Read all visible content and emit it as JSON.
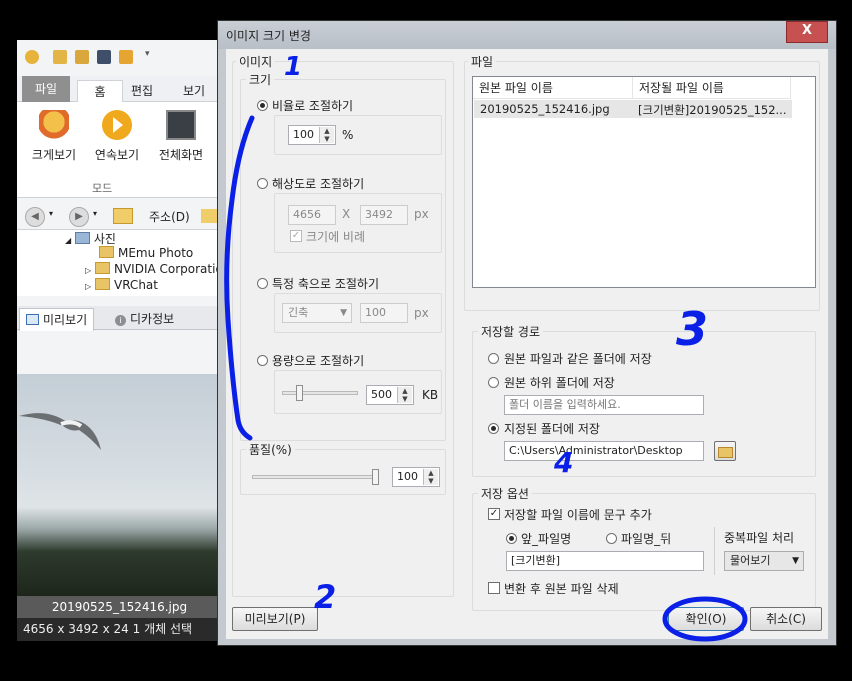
{
  "background_app": {
    "ribbon_tabs": [
      "파일",
      "홈",
      "편집",
      "보기"
    ],
    "ribbon_buttons": [
      "크게보기",
      "연속보기",
      "전체화면"
    ],
    "ribbon_group": "모드",
    "address_label": "주소(D)",
    "tree": {
      "root": "사진",
      "items": [
        "MEmu Photo",
        "NVIDIA Corporation",
        "VRChat"
      ]
    },
    "panel_tabs": [
      "미리보기",
      "디카정보"
    ],
    "file_name": "20190525_152416.jpg",
    "status_text": "4656 x 3492 x 24     1 개체 선택"
  },
  "dialog": {
    "title": "이미지 크기 변경",
    "close_label": "X",
    "image_group": "이미지",
    "size_group": "크기",
    "size_options": {
      "ratio": {
        "label": "비율로 조절하기",
        "value": "100",
        "unit": "%"
      },
      "resolution": {
        "label": "해상도로 조절하기",
        "width": "4656",
        "x_sep": "X",
        "height": "3492",
        "unit": "px",
        "keep_ratio": "크기에 비례"
      },
      "axis": {
        "label": "특정 축으로 조절하기",
        "axis_select": "긴축",
        "value": "100",
        "unit": "px"
      },
      "filesize": {
        "label": "용량으로 조절하기",
        "value": "500",
        "unit": "KB"
      }
    },
    "quality": {
      "label": "품질(%)",
      "value": "100"
    },
    "file_group": "파일",
    "file_table": {
      "columns": [
        "원본 파일 이름",
        "저장될 파일 이름"
      ],
      "rows": [
        [
          "20190525_152416.jpg",
          "[크기변환]20190525_152..."
        ]
      ]
    },
    "save_path": {
      "label": "저장할 경로",
      "options": [
        "원본 파일과 같은 폴더에 저장",
        "원본 하위 폴더에 저장",
        "지정된 폴더에 저장"
      ],
      "subfolder_placeholder": "폴더 이름을 입력하세요.",
      "folder_path": "C:\\Users\\Administrator\\Desktop"
    },
    "save_options": {
      "label": "저장 옵션",
      "add_text_label": "저장할 파일 이름에 문구 추가",
      "position_front": "앞_파일명",
      "position_back": "파일명_뒤",
      "text_value": "[크기변환]",
      "duplicate_label": "중복파일 처리",
      "duplicate_value": "물어보기",
      "delete_original": "변환 후 원본 파일 삭제"
    },
    "buttons": {
      "preview": "미리보기(P)",
      "ok": "확인(O)",
      "cancel": "취소(C)"
    }
  },
  "annotations": [
    "1",
    "2",
    "3",
    "4"
  ],
  "colors": {
    "annotation": "#0a20e6",
    "close": "#c75050"
  }
}
